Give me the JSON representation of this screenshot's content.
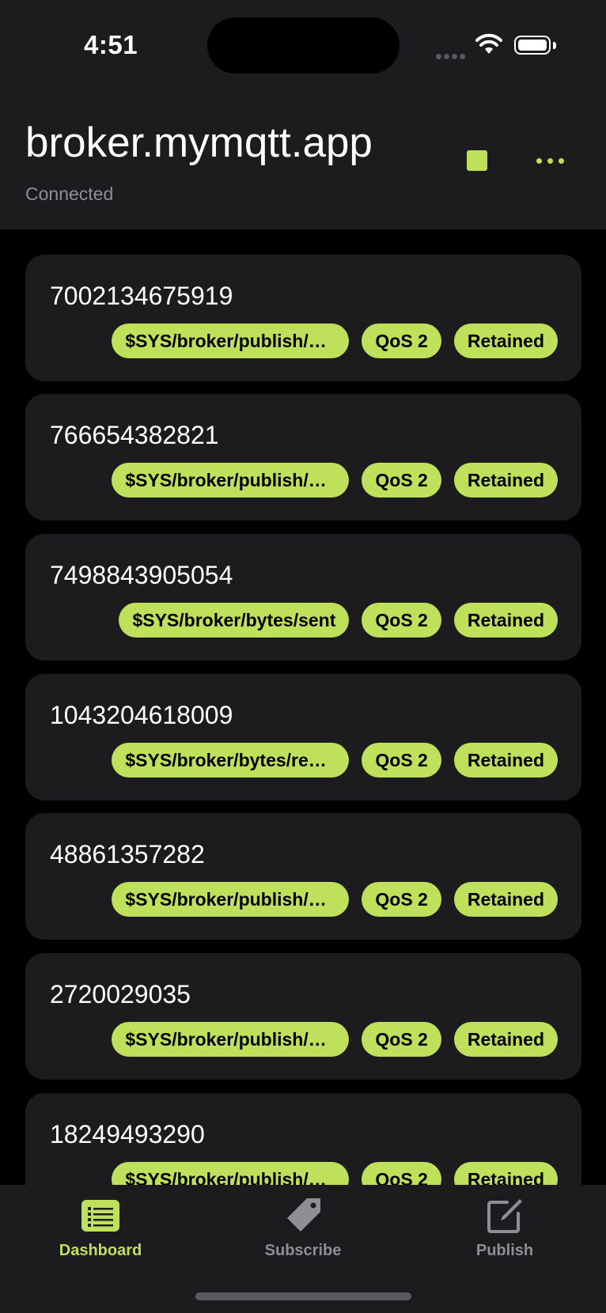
{
  "status": {
    "time": "4:51"
  },
  "header": {
    "title": "broker.mymqtt.app",
    "subtitle": "Connected"
  },
  "accent_color": "#bfe05b",
  "messages": [
    {
      "value": "7002134675919",
      "topic": "$SYS/broker/publish/bytes...",
      "qos": "QoS 2",
      "retained": "Retained"
    },
    {
      "value": "766654382821",
      "topic": "$SYS/broker/publish/bytes...",
      "qos": "QoS 2",
      "retained": "Retained"
    },
    {
      "value": "7498843905054",
      "topic": "$SYS/broker/bytes/sent",
      "qos": "QoS 2",
      "retained": "Retained"
    },
    {
      "value": "1043204618009",
      "topic": "$SYS/broker/bytes/received",
      "qos": "QoS 2",
      "retained": "Retained"
    },
    {
      "value": "48861357282",
      "topic": "$SYS/broker/publish/mess...",
      "qos": "QoS 2",
      "retained": "Retained"
    },
    {
      "value": "2720029035",
      "topic": "$SYS/broker/publish/mess...",
      "qos": "QoS 2",
      "retained": "Retained"
    },
    {
      "value": "18249493290",
      "topic": "$SYS/broker/publish/mess...",
      "qos": "QoS 2",
      "retained": "Retained"
    }
  ],
  "tabs": [
    {
      "label": "Dashboard",
      "icon": "list-icon",
      "active": true
    },
    {
      "label": "Subscribe",
      "icon": "tag-icon",
      "active": false
    },
    {
      "label": "Publish",
      "icon": "compose-icon",
      "active": false
    }
  ]
}
